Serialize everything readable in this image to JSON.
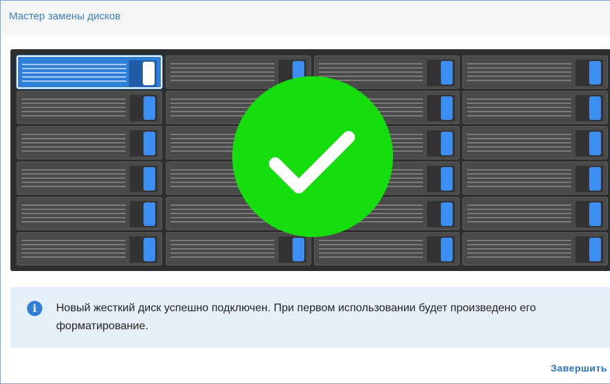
{
  "window": {
    "title": "Мастер замены дисков"
  },
  "rack": {
    "rows": 6,
    "columns": 4,
    "selected_bay": "row 1, column 1",
    "colors": {
      "rack": "#2e2e2e",
      "bay": "#4a4a4a",
      "selected_bay": "#2f7ed8",
      "led": "#3d8ef2"
    }
  },
  "status": {
    "icon": "checkmark-icon",
    "color": "#16dd0c"
  },
  "info": {
    "icon": "info-icon",
    "message": "Новый жесткий диск успешно подключен. При первом использовании будет произведено его форматирование."
  },
  "footer": {
    "finish_label": "Завершить"
  }
}
